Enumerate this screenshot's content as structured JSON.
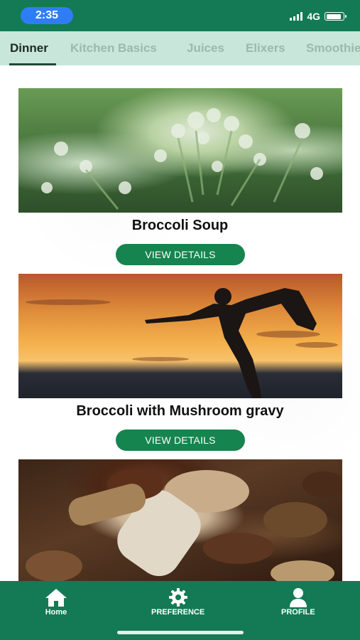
{
  "status_bar": {
    "time": "2:35",
    "network": "4G",
    "signal_bars": 4,
    "battery_level": 0.9,
    "accent_color": "#137a55",
    "time_pill_color": "#2f7df6"
  },
  "tabs": [
    {
      "label": "Dinner",
      "active": true
    },
    {
      "label": "Kitchen Basics",
      "active": false
    },
    {
      "label": "Juices",
      "active": false
    },
    {
      "label": "Elixers",
      "active": false
    },
    {
      "label": "Smoothies",
      "active": false
    }
  ],
  "recipes": [
    {
      "title": "Broccoli Soup",
      "image": "broccoli-image",
      "button": "VIEW DETAILS"
    },
    {
      "title": "Broccoli with Mushroom gravy",
      "image": "yoga-sunset-image",
      "button": "VIEW DETAILS"
    },
    {
      "title": "",
      "image": "mushrooms-image",
      "button": ""
    }
  ],
  "bottom_nav": [
    {
      "label": "Home",
      "icon": "home-icon"
    },
    {
      "label": "PREFERENCE",
      "icon": "gear-icon"
    },
    {
      "label": "PROFILE",
      "icon": "user-icon"
    }
  ]
}
